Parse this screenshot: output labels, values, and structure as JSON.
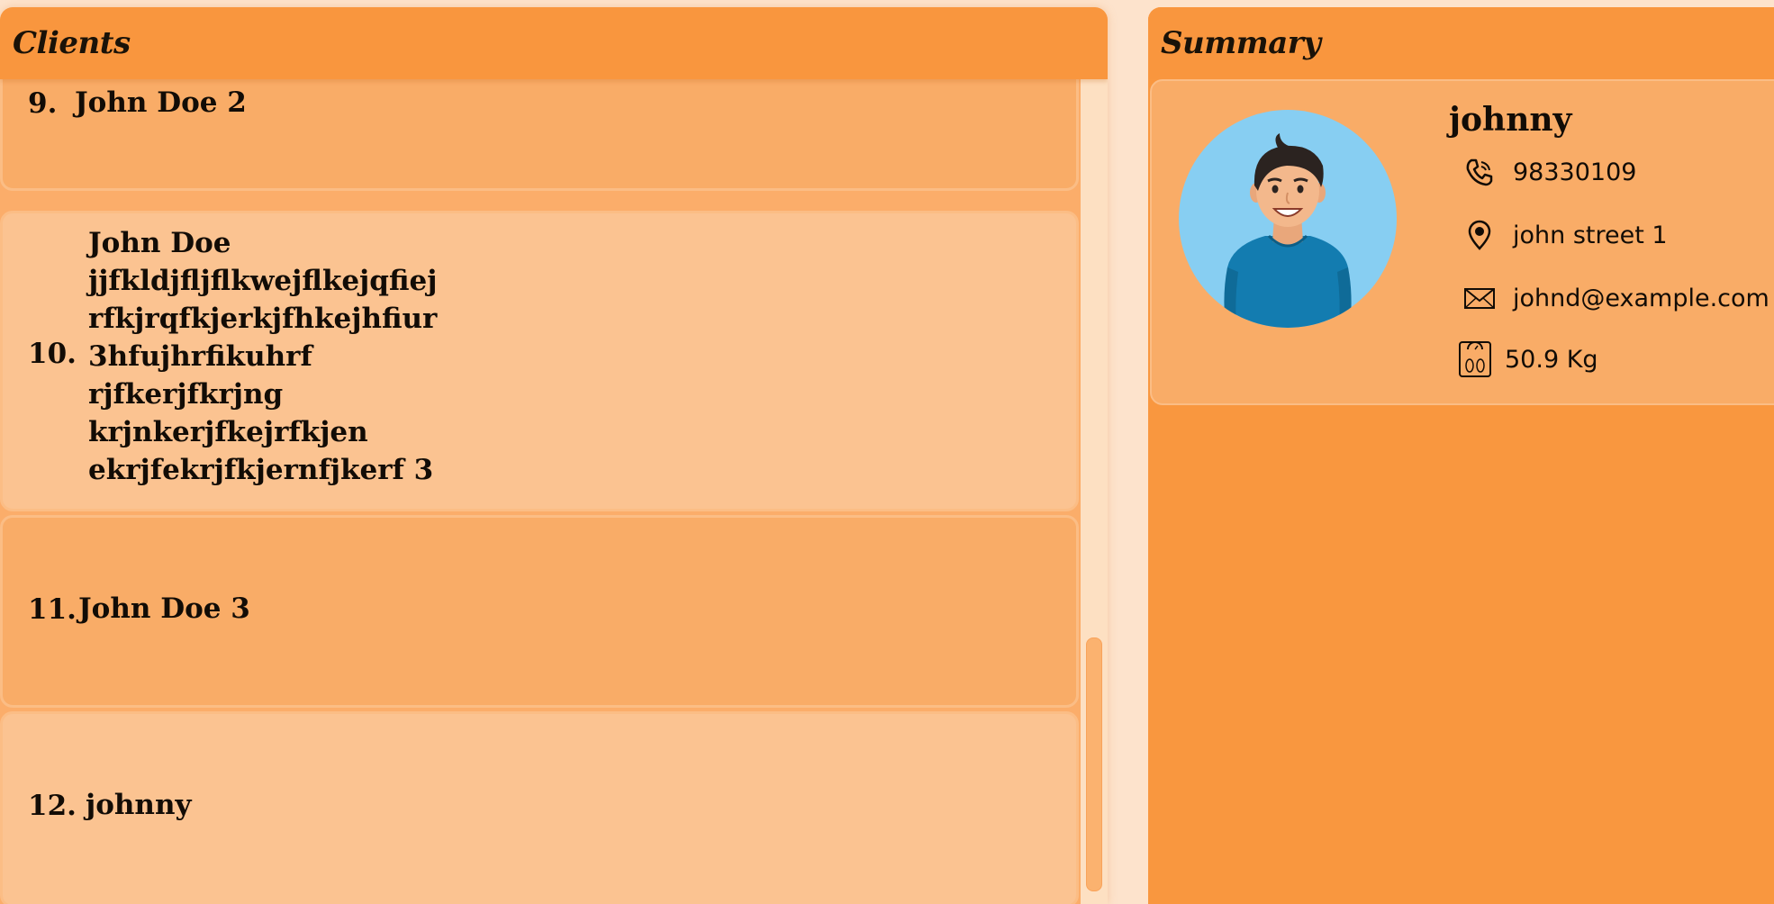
{
  "clients_panel": {
    "title": "Clients",
    "items": [
      {
        "index": "9.",
        "name": "John Doe 2"
      },
      {
        "index": "10.",
        "name": "John Doe\njjfkldjfljflkwejflkejqfiej\nrfkjrqfkjerkjfhkejhfiur\n3hfujhrfikuhrf\nrjfkerjfkrjng\nkrjnkerjfkejrfkjen\nekrjfekrjfkjernfjkerf 3"
      },
      {
        "index": "11.",
        "name": "John Doe 3"
      },
      {
        "index": "12.",
        "name": "johnny"
      }
    ]
  },
  "summary_panel": {
    "title": "Summary",
    "name": "johnny",
    "phone": "98330109",
    "address": "john street 1",
    "email": "johnd@example.com",
    "weight": "50.9 Kg",
    "icons": [
      "phone-icon",
      "location-pin-icon",
      "email-icon",
      "weight-scale-icon"
    ]
  },
  "colors": {
    "header": "#f9963e",
    "card_odd": "#f9ac67",
    "card_even": "#fbc391",
    "avatar_bg": "#87cef2"
  }
}
